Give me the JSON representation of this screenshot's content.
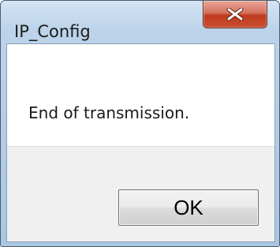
{
  "window": {
    "title": "IP_Config",
    "close_icon": "close-x-icon"
  },
  "dialog": {
    "message": "End of transmission.",
    "ok_label": "OK"
  }
}
